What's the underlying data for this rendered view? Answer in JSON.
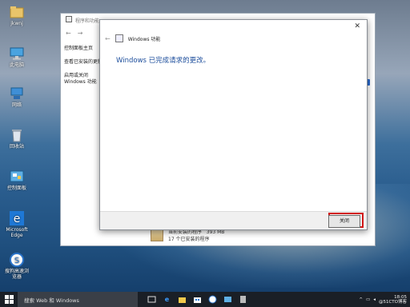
{
  "desktop_icons": [
    {
      "label": "jkwnj",
      "icon": "user-folder-icon"
    },
    {
      "label": "此电脑",
      "icon": "computer-icon"
    },
    {
      "label": "网络",
      "icon": "network-icon"
    },
    {
      "label": "回收站",
      "icon": "recycle-bin-icon"
    },
    {
      "label": "控制面板",
      "icon": "control-panel-icon"
    },
    {
      "label": "Microsoft Edge",
      "icon": "edge-icon"
    },
    {
      "label": "搜狗高速浏览器",
      "icon": "sogou-browser-icon"
    }
  ],
  "background_window": {
    "title": "程序和功能",
    "side_links": [
      "控制面板主页",
      "查看已安装的更新",
      "启用或关闭 Windows 功能"
    ],
    "bottom_row": {
      "text": "当前安装的程序",
      "size": "393 MB",
      "sub": "17 个已安装的程序"
    }
  },
  "dialog": {
    "title": "Windows 功能",
    "message": "Windows 已完成请求的更改。",
    "close_button_label": "关闭",
    "close_glyph": "✕"
  },
  "taskbar": {
    "search_placeholder": "搜索 Web 和 Windows",
    "clock_time": "18:05",
    "watermark": "@51CTO博客"
  }
}
